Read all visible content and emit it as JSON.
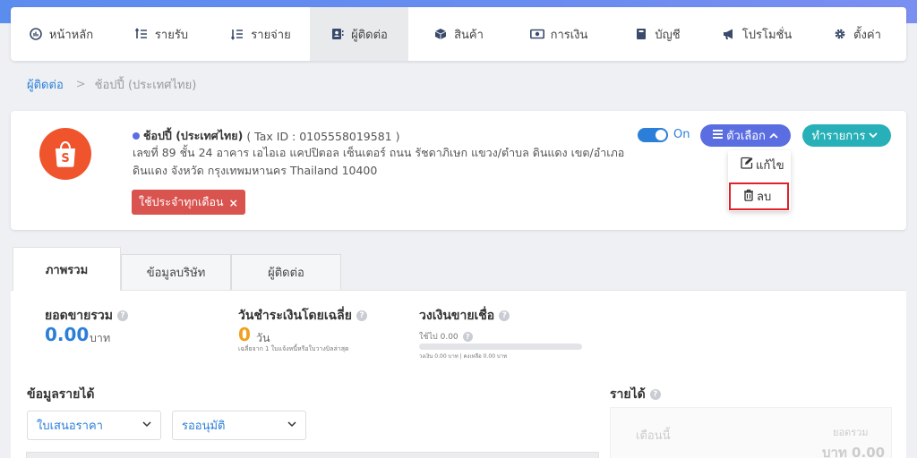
{
  "nav": {
    "items": [
      {
        "label": "หน้าหลัก",
        "icon": "dashboard-icon"
      },
      {
        "label": "รายรับ",
        "icon": "income-icon"
      },
      {
        "label": "รายจ่าย",
        "icon": "expense-icon"
      },
      {
        "label": "ผู้ติดต่อ",
        "icon": "contacts-icon"
      },
      {
        "label": "สินค้า",
        "icon": "box-icon"
      },
      {
        "label": "การเงิน",
        "icon": "money-icon"
      },
      {
        "label": "บัญชี",
        "icon": "book-icon"
      },
      {
        "label": "โปรโมชั่น",
        "icon": "megaphone-icon"
      },
      {
        "label": "ตั้งค่า",
        "icon": "gear-icon"
      }
    ],
    "active_index": 3
  },
  "breadcrumb": {
    "parent": "ผู้ติดต่อ",
    "separator": ">",
    "current": "ช้อปปี้ (ประเทศไทย)"
  },
  "contact": {
    "name": "ช้อปปี้ (ประเทศไทย)",
    "tax_id": "( Tax ID : 0105558019581 )",
    "address": "เลขที่ 89 ชั้น 24 อาคาร เอไอเอ แคปปิตอล เซ็นเตอร์ ถนน รัชดาภิเษก แขวง/ตำบล ดินแดง เขต/อำเภอ ดินแดง จังหวัด กรุงเทพมหานคร Thailand 10400",
    "tag": "ใช้ประจำทุกเดือน",
    "tag_remove": "×",
    "toggle_label": "On",
    "options_label": "ตัวเลือก",
    "action_label": "ทำรายการ",
    "menu": {
      "edit": "แก้ไข",
      "delete": "ลบ"
    },
    "colors": {
      "logo": "#f0542d",
      "options": "#5b6ee1",
      "action": "#27b0b8",
      "tag": "#d9534f",
      "highlight": "#e0232b"
    }
  },
  "tabs": [
    "ภาพรวม",
    "ข้อมูลบริษัท",
    "ผู้ติดต่อ"
  ],
  "stats": {
    "total_sales": {
      "title": "ยอดขายรวม",
      "value": "0.00",
      "unit": "บาท"
    },
    "avg_pay_days": {
      "title": "วันชำระเงินโดยเฉลี่ย",
      "value": "0",
      "unit": "วัน",
      "note": "เฉลี่ยจาก 1 ใบแจ้งหนี้หรือใบวางบิลล่าสุด"
    },
    "credit": {
      "title": "วงเงินขายเชื่อ",
      "used": "ใช้ไป 0.00",
      "note": "วงเงิน 0.00 บาท | คงเหลือ 0.00 บาท",
      "used_fraction": 0
    }
  },
  "income": {
    "title": "ข้อมูลรายได้",
    "filter_doc": "ใบเสนอราคา",
    "filter_status": "รออนุมัติ",
    "side_title": "รายได้",
    "side_select": "เดือนนี้",
    "side_label": "ยอดรวม",
    "side_value": "บาท 0.00"
  }
}
